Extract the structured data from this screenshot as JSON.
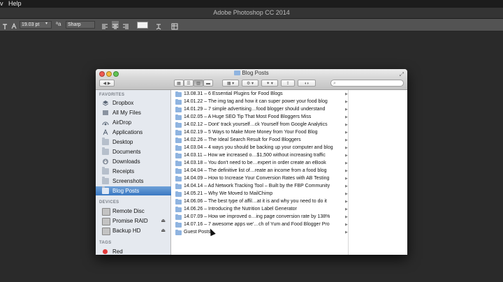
{
  "menubar": {
    "item_v": "v",
    "help": "Help"
  },
  "ps": {
    "title": "Adobe Photoshop CC 2014",
    "font_size": "19.03 pt",
    "aa_icon_label": "ªa",
    "antialias": "Sharp"
  },
  "finder": {
    "window_title": "Blog Posts",
    "search_placeholder": "",
    "favorites_header": "FAVORITES",
    "favorites": [
      {
        "label": "Dropbox",
        "icon": "dropbox-icon"
      },
      {
        "label": "All My Files",
        "icon": "all-files-icon"
      },
      {
        "label": "AirDrop",
        "icon": "airdrop-icon"
      },
      {
        "label": "Applications",
        "icon": "applications-icon"
      },
      {
        "label": "Desktop",
        "icon": "folder-icon"
      },
      {
        "label": "Documents",
        "icon": "folder-icon"
      },
      {
        "label": "Downloads",
        "icon": "downloads-icon"
      },
      {
        "label": "Receipts",
        "icon": "folder-icon"
      },
      {
        "label": "Screenshots",
        "icon": "folder-icon"
      },
      {
        "label": "Blog Posts",
        "icon": "folder-icon",
        "selected": true
      }
    ],
    "devices_header": "DEVICES",
    "devices": [
      {
        "label": "Remote Disc",
        "eject": false
      },
      {
        "label": "Promise RAID",
        "eject": true
      },
      {
        "label": "Backup HD",
        "eject": true
      }
    ],
    "tags_header": "TAGS",
    "tags": [
      {
        "label": "Red",
        "color": "#e23a3a"
      }
    ],
    "files": [
      "13.08.31 – 6 Essential Plugins for Food Blogs",
      "14.01.22 – The img tag and how it can super power your food blog",
      "14.01.29 – 7 simple advertising…food blogger should understand",
      "14.02.05 – A Huge SEO Tip That Most Food Bloggers Miss",
      "14.02.12 – Dont' track yourself…ck Yourself from Google Analytics",
      "14.02.19 – 5 Ways to Make More Money from Your Food Blog",
      "14.02.26 – The Ideal Search Result for Food Bloggers",
      "14.03.04 – 4 ways you should be backing up your computer and blog",
      "14.03.11 – How we increased o…$1,500 without increasing traffic",
      "14.03.18 – You don't need to be…expert in order create an eBook",
      "14.04.04 – The definitive list of…reate an income from a food blog",
      "14.04.09 – How to Increase Your Conversion Rates with AB Testing",
      "14.04.14 – Ad Network Tracking Tool – Built by the FBP Community",
      "14.05.21 – Why We Moved to MailChimp",
      "14.06.06 – The best type of affil…at it is and why you need to do it",
      "14.06.26 – Introducing the Nutrition Label Generator",
      "14.07.09 – How we improved o…ing page conversion rate by 138%",
      "14.07.16 – 7 awesome apps we'…ch of Yum and Food Blogger Pro",
      "Guest Posts"
    ],
    "colors": {
      "selection": "#3a78c2",
      "sidebar": "#e5e9ef",
      "folder": "#8fb4e0"
    }
  }
}
